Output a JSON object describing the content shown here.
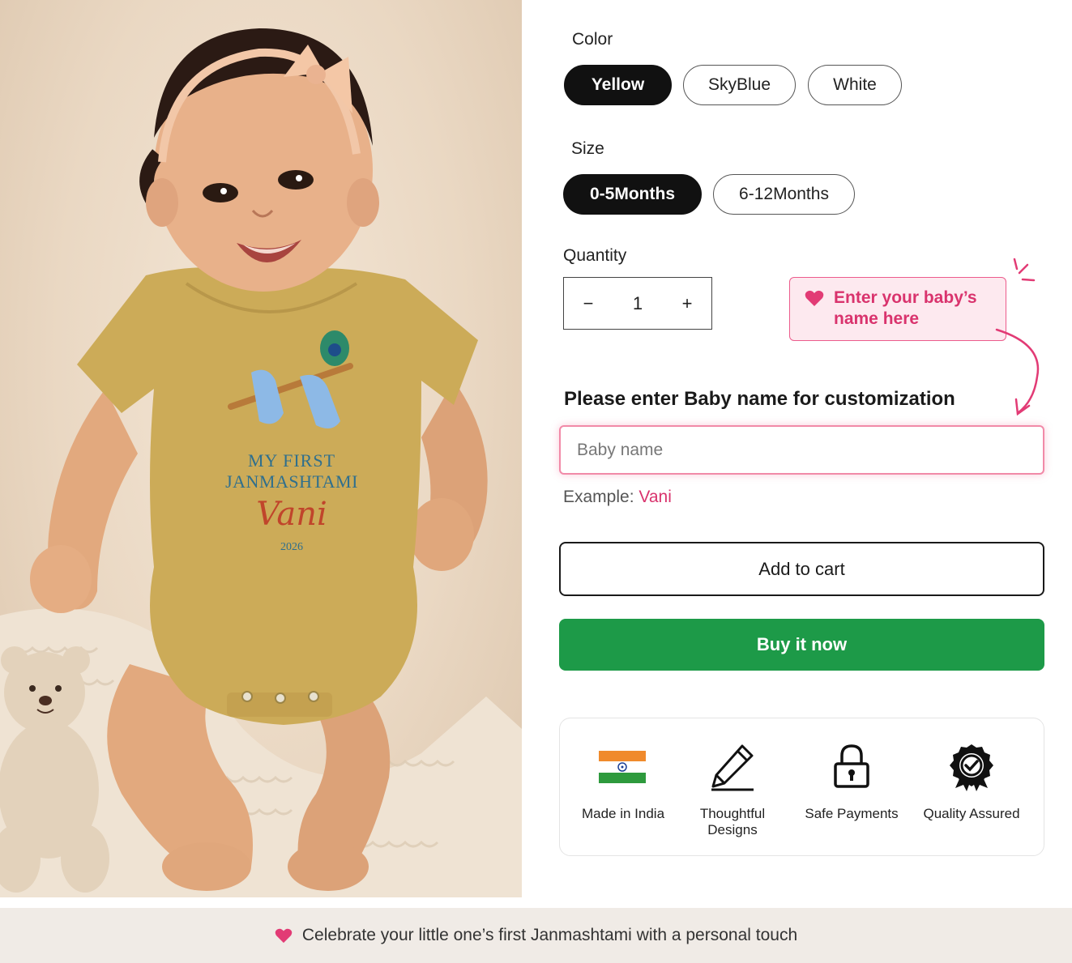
{
  "product_image": {
    "print_line1": "MY FIRST",
    "print_line2": "JANMASHTAMI",
    "print_name": "Vani",
    "print_year": "2026"
  },
  "color": {
    "label": "Color",
    "options": [
      "Yellow",
      "SkyBlue",
      "White"
    ],
    "selected": "Yellow"
  },
  "size": {
    "label": "Size",
    "options": [
      "0-5Months",
      "6-12Months"
    ],
    "selected": "0-5Months"
  },
  "quantity": {
    "label": "Quantity",
    "minus": "−",
    "value": "1",
    "plus": "+"
  },
  "hint": {
    "line1": "Enter your baby’s",
    "line2": "name here"
  },
  "customization": {
    "title": "Please enter Baby name for customization",
    "placeholder": "Baby name",
    "example_label": "Example:",
    "example_value": "Vani"
  },
  "actions": {
    "add_to_cart": "Add to cart",
    "buy_now": "Buy it now"
  },
  "badges": [
    {
      "label": "Made in India",
      "icon": "india-flag-icon"
    },
    {
      "label": "Thoughtful Designs",
      "icon": "pencil-icon"
    },
    {
      "label": "Safe Payments",
      "icon": "lock-icon"
    },
    {
      "label": "Quality Assured",
      "icon": "award-icon"
    }
  ],
  "footer": {
    "text": "Celebrate your little one’s first Janmashtami with a personal touch"
  },
  "colors": {
    "accent_pink": "#d9336d",
    "buy_green": "#1d9a48",
    "selected_pill": "#111111"
  }
}
